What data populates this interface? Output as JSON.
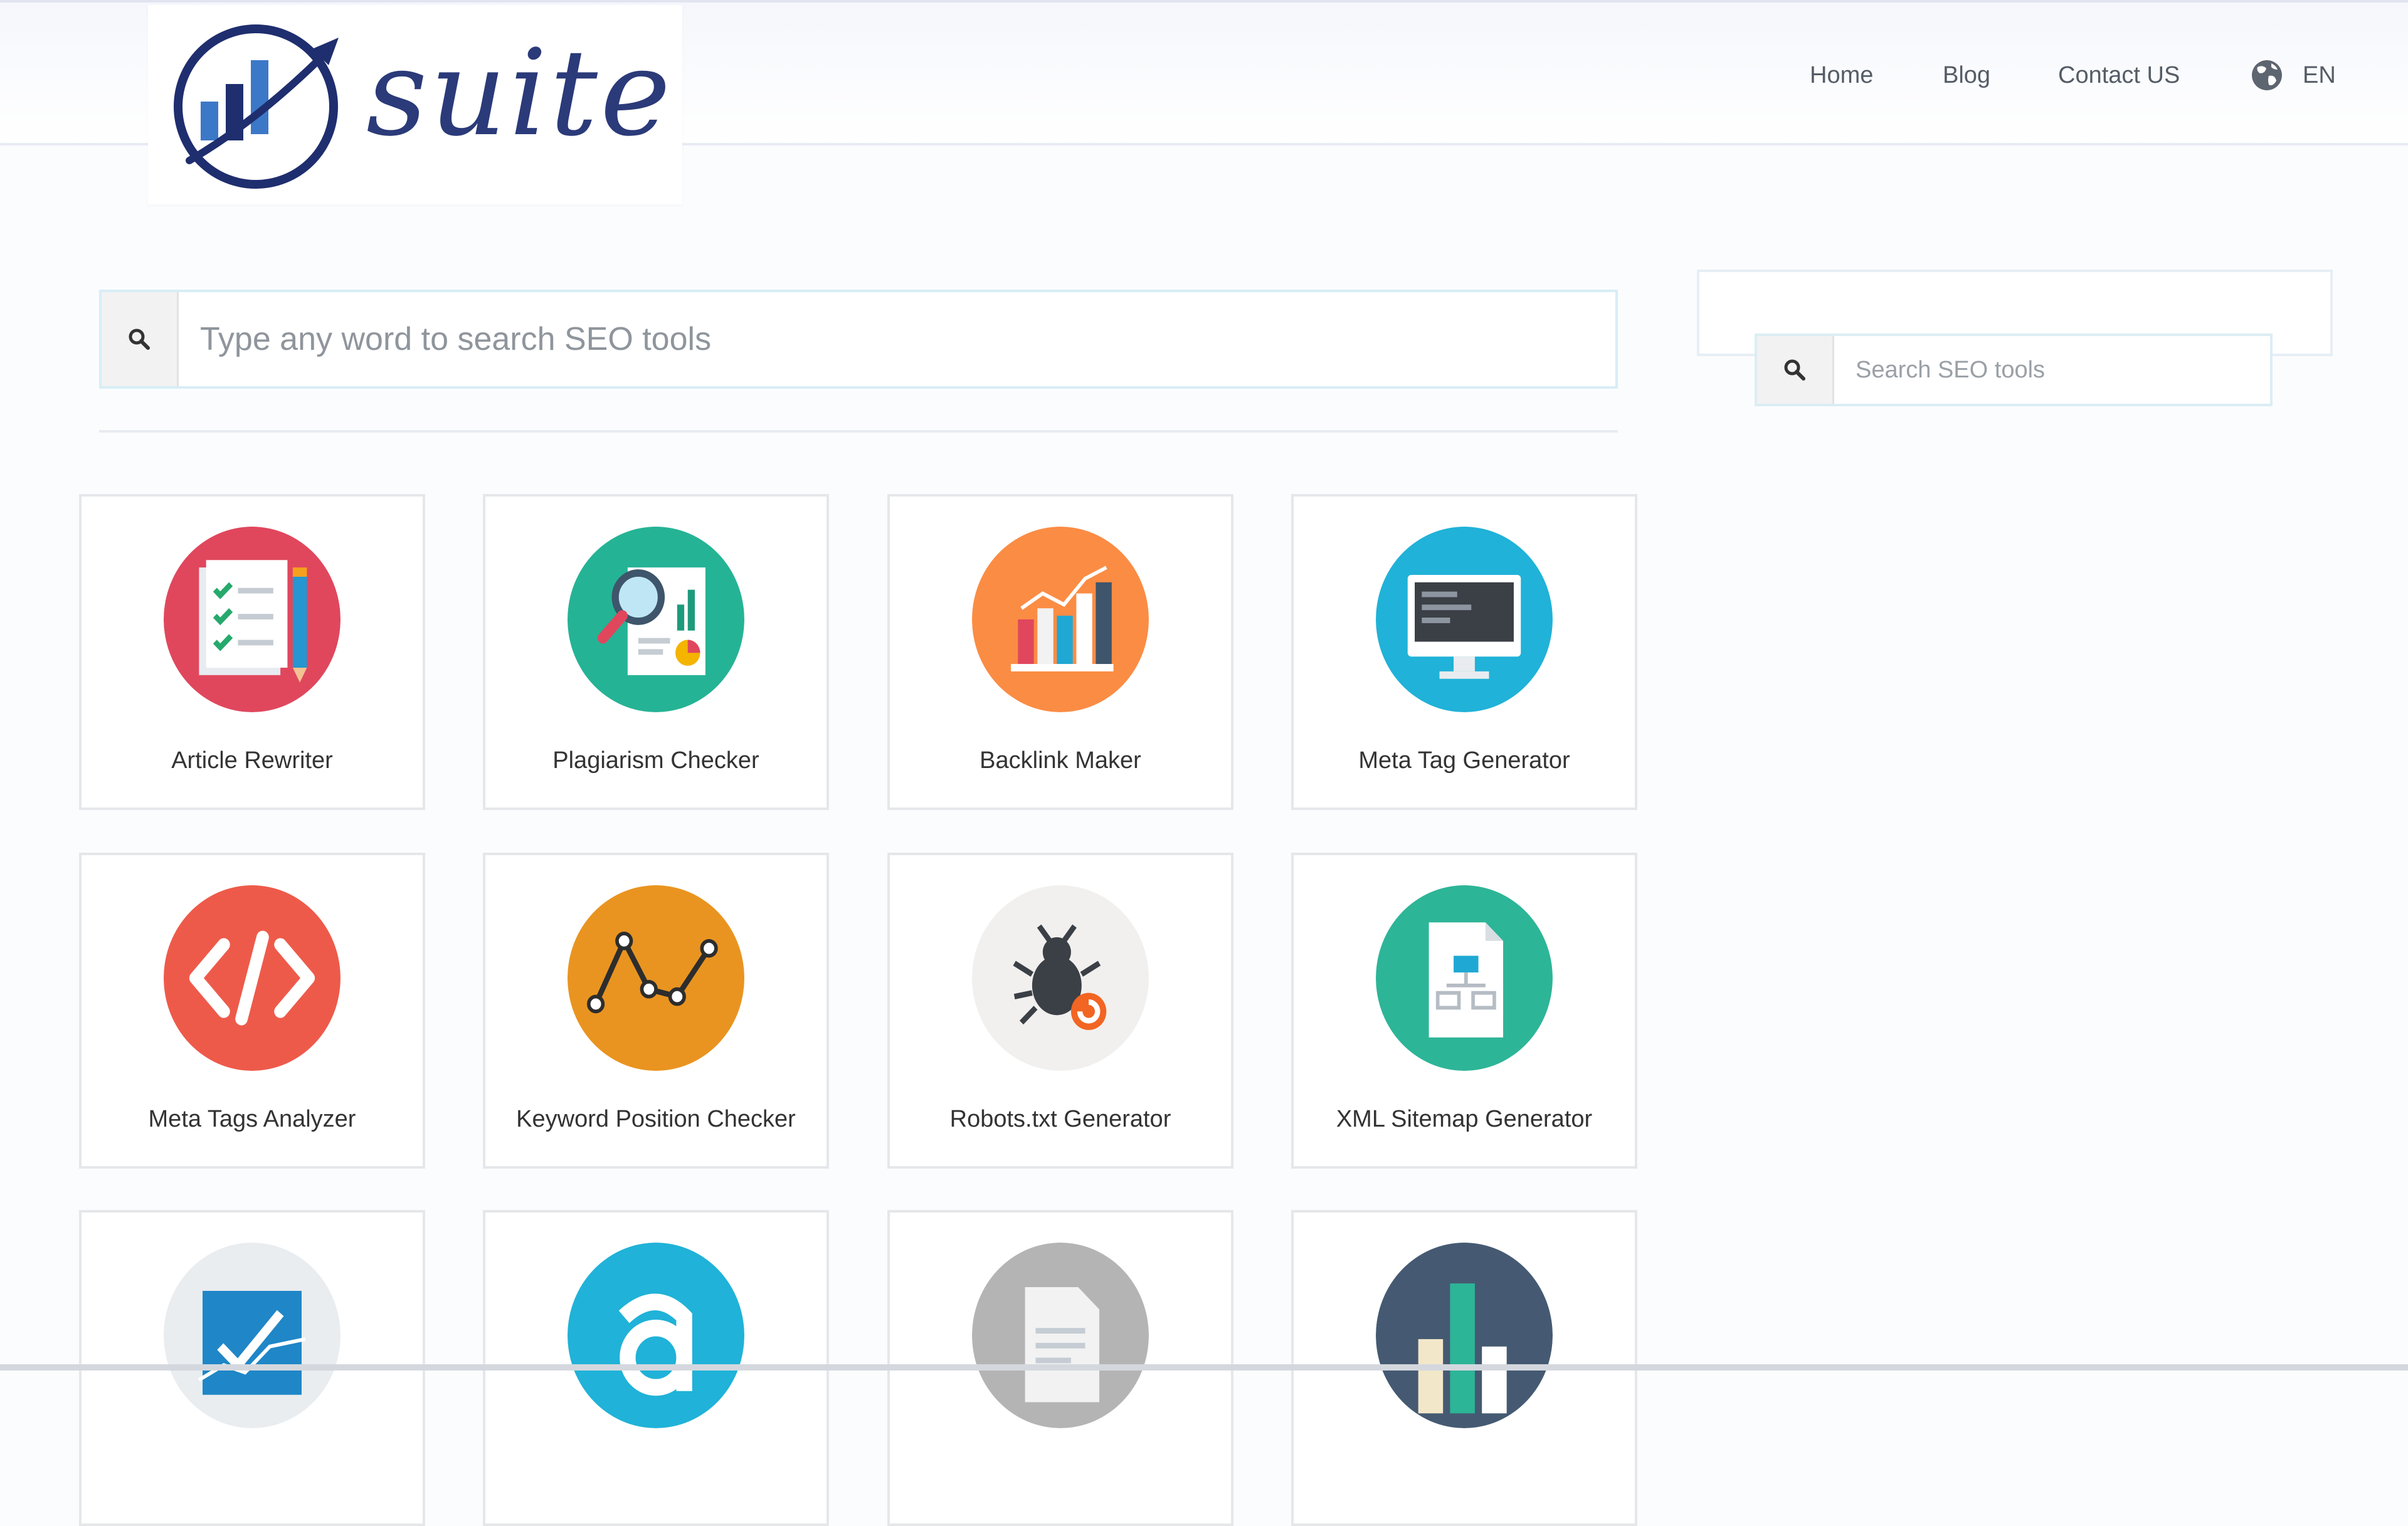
{
  "brand": {
    "name": "suite",
    "colors": {
      "navy": "#1f2e6e",
      "blue": "#3c78c8"
    }
  },
  "nav": {
    "home": "Home",
    "blog": "Blog",
    "contact": "Contact US",
    "language": "EN",
    "language_icon": "globe-icon"
  },
  "search": {
    "placeholder": "Type any word to search SEO tools",
    "icon": "search-icon"
  },
  "sidebar": {
    "search_placeholder": "Search SEO tools"
  },
  "tools": [
    {
      "label": "Article Rewriter",
      "icon": "document-checklist-icon",
      "color": "#e0475d"
    },
    {
      "label": "Plagiarism Checker",
      "icon": "magnifier-report-icon",
      "color": "#25b395"
    },
    {
      "label": "Backlink Maker",
      "icon": "bar-chart-icon",
      "color": "#fb8c44"
    },
    {
      "label": "Meta Tag Generator",
      "icon": "monitor-icon",
      "color": "#20b2d8"
    },
    {
      "label": "Meta Tags Analyzer",
      "icon": "code-icon",
      "color": "#ee5a4a"
    },
    {
      "label": "Keyword Position Checker",
      "icon": "line-graph-icon",
      "color": "#e99420"
    },
    {
      "label": "Robots.txt Generator",
      "icon": "bug-icon",
      "color": "#f1f0ee"
    },
    {
      "label": "XML Sitemap Generator",
      "icon": "sitemap-file-icon",
      "color": "#2db597"
    },
    {
      "label": "",
      "icon": "chart-check-icon",
      "color": "#e9edf0"
    },
    {
      "label": "",
      "icon": "letter-a-icon",
      "color": "#20b2d8"
    },
    {
      "label": "",
      "icon": "document-icon",
      "color": "#b4b4b4"
    },
    {
      "label": "",
      "icon": "bar-columns-icon",
      "color": "#455a72"
    }
  ]
}
